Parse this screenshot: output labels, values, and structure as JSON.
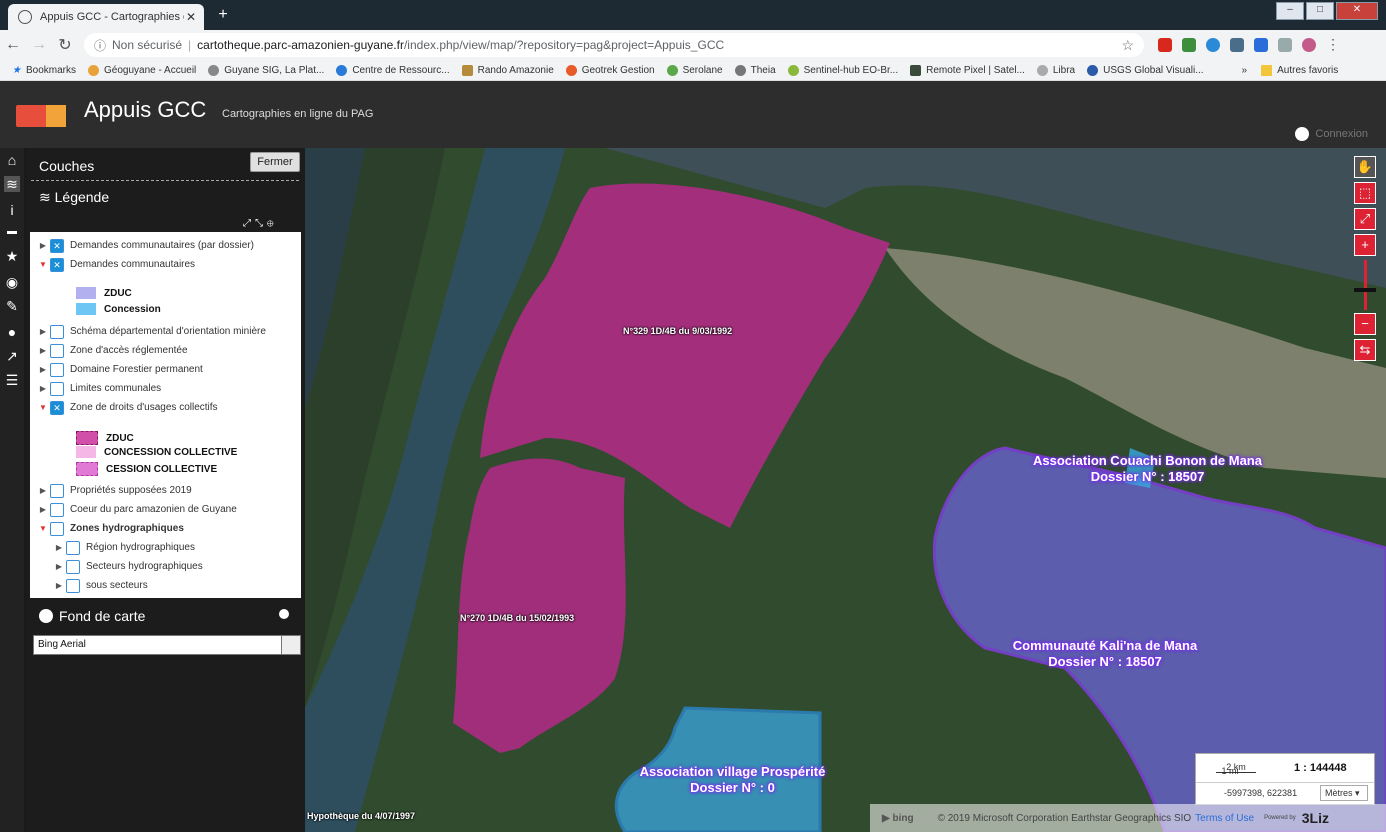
{
  "browser": {
    "tab_title": "Appuis GCC - Cartographies en l",
    "url_security": "Non sécurisé",
    "url_host": "cartotheque.parc-amazonien-guyane.fr",
    "url_path": "/index.php/view/map/?repository=pag&project=Appuis_GCC",
    "bookmarks": [
      "Bookmarks",
      "Géoguyane - Accueil",
      "Guyane SIG, La Plat...",
      "Centre de Ressourc...",
      "Rando Amazonie",
      "Geotrek Gestion",
      "Serolane",
      "Theia",
      "Sentinel-hub EO-Br...",
      "Remote Pixel | Satel...",
      "Libra",
      "USGS Global Visuali..."
    ],
    "bookmarks_more": "»",
    "other_bookmarks": "Autres favoris"
  },
  "app": {
    "title": "Appuis GCC",
    "subtitle": "Cartographies en ligne du PAG",
    "login": "Connexion"
  },
  "panel": {
    "layers_title": "Couches",
    "close_label": "Fermer",
    "legend_title": "Légende",
    "layers": [
      {
        "label": "Demandes communautaires (par dossier)",
        "checked": true,
        "expanded": false
      },
      {
        "label": "Demandes communautaires",
        "checked": true,
        "expanded": true
      },
      {
        "label": "Schéma départemental d'orientation minière",
        "checked": false,
        "expanded": false
      },
      {
        "label": "Zone d'accès réglementée",
        "checked": false,
        "expanded": false
      },
      {
        "label": "Domaine Forestier permanent",
        "checked": false,
        "expanded": false
      },
      {
        "label": "Limites communales",
        "checked": false,
        "expanded": false
      },
      {
        "label": "Zone de droits d'usages collectifs",
        "checked": true,
        "expanded": true
      },
      {
        "label": "Propriétés supposées 2019",
        "checked": false,
        "expanded": false
      },
      {
        "label": "Coeur du parc amazonien de Guyane",
        "checked": false,
        "expanded": false
      },
      {
        "label": "Zones hydrographiques",
        "checked": false,
        "expanded": true
      },
      {
        "label": "Région hydrographiques",
        "checked": false,
        "expanded": false
      },
      {
        "label": "Secteurs hydrographiques",
        "checked": false,
        "expanded": false
      },
      {
        "label": "sous secteurs",
        "checked": false,
        "expanded": false
      }
    ],
    "legend_demandes": [
      {
        "label": "ZDUC",
        "color": "#b3b0f0"
      },
      {
        "label": "Concession",
        "color": "#6ec6f5"
      }
    ],
    "legend_zones": [
      {
        "label": "ZDUC",
        "color": "#d14fa8"
      },
      {
        "label": "CONCESSION COLLECTIVE",
        "color": "#f5b8e6"
      },
      {
        "label": "CESSION COLLECTIVE",
        "color": "#e07ad4"
      }
    ],
    "basemap_title": "Fond de carte",
    "basemap_value": "Bing Aerial"
  },
  "map": {
    "labels": {
      "n329": "N°329 1D/4B du 9/03/1992",
      "n270": "N°270 1D/4B du 15/02/1993",
      "couachi_1": "Association Couachi Bonon de Mana",
      "couachi_2": "Dossier N° : 18507",
      "kalina_1": "Communauté Kali'na de Mana",
      "kalina_2": "Dossier N° : 18507",
      "prosperite_1": "Association village Prospérité",
      "prosperite_2": "Dossier N° : 0",
      "hypotheque": "Hypothèque du 4/07/1997"
    },
    "scale": {
      "km": "2 km",
      "mi": "1 mi",
      "ratio": "1 : 144448",
      "coords": "-5997398, 622381",
      "unit": "Mètres"
    },
    "attribution": {
      "bing": "bing",
      "text": "© 2019 Microsoft Corporation Earthstar Geographics SIO",
      "terms": "Terms of Use",
      "powered": "Powered by",
      "brand": "3Liz"
    },
    "colors": {
      "zduc_magenta": "#c0278f",
      "demande_violet": "#6b63d8",
      "concession_blue": "#3aa6e0"
    }
  }
}
